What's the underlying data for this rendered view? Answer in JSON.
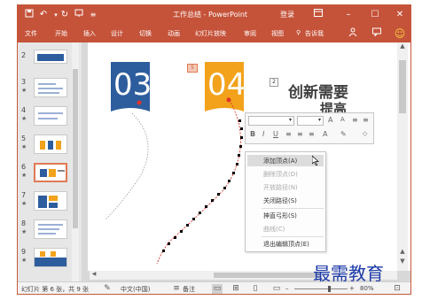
{
  "window": {
    "title": "工作总结 - PowerPoint",
    "login": "登录",
    "accent_color": "#c5533a"
  },
  "quick_access": {
    "save_icon": "save-icon",
    "undo_icon": "undo-icon",
    "redo_icon": "redo-icon",
    "present_icon": "present-icon",
    "customize_icon": "customize-icon"
  },
  "ribbon": {
    "tabs": [
      "文件",
      "开始",
      "插入",
      "设计",
      "切换",
      "动画",
      "幻灯片放映",
      "审阅",
      "视图",
      "告诉我"
    ],
    "right_icons": [
      "share-icon",
      "comment-icon",
      "smiley-icon"
    ]
  },
  "thumbnails": {
    "items": [
      {
        "num": "2",
        "star": ""
      },
      {
        "num": "3",
        "star": "★"
      },
      {
        "num": "4",
        "star": "★"
      },
      {
        "num": "5",
        "star": "★"
      },
      {
        "num": "6",
        "star": "★"
      },
      {
        "num": "7",
        "star": "★"
      },
      {
        "num": "8",
        "star": "★"
      },
      {
        "num": "9",
        "star": "★"
      }
    ],
    "selected_num": "6"
  },
  "slide": {
    "heading1": "创新需要",
    "heading2": "提高",
    "block1_num": "03",
    "block2_num": "04",
    "tag1": "5",
    "tag2": "2",
    "block1_color": "#2e5d9e",
    "block2_color": "#f2a21b"
  },
  "mini_toolbar": {
    "row1": [
      "A",
      "A",
      "≡",
      "≡"
    ],
    "row2": [
      "B",
      "I",
      "U",
      "≡",
      "≡",
      "≡",
      "A",
      "✎"
    ]
  },
  "context_menu": {
    "items": [
      {
        "label": "添加顶点(A)",
        "disabled": false,
        "highlighted": true
      },
      {
        "label": "删除顶点(D)",
        "disabled": true
      },
      {
        "label": "开放路径(N)",
        "disabled": true
      },
      {
        "label": "关闭路径(S)",
        "disabled": false
      },
      {
        "label": "抻直弓形(S)",
        "disabled": false
      },
      {
        "label": "曲线(C)",
        "disabled": true
      },
      {
        "label": "退出编辑顶点(E)",
        "disabled": false
      }
    ]
  },
  "status": {
    "slide_info": "幻灯片 第 6 张，共 9 张",
    "language": "中文(中国)",
    "notes": "备注",
    "zoom": "80%"
  },
  "watermark": "最需教育"
}
